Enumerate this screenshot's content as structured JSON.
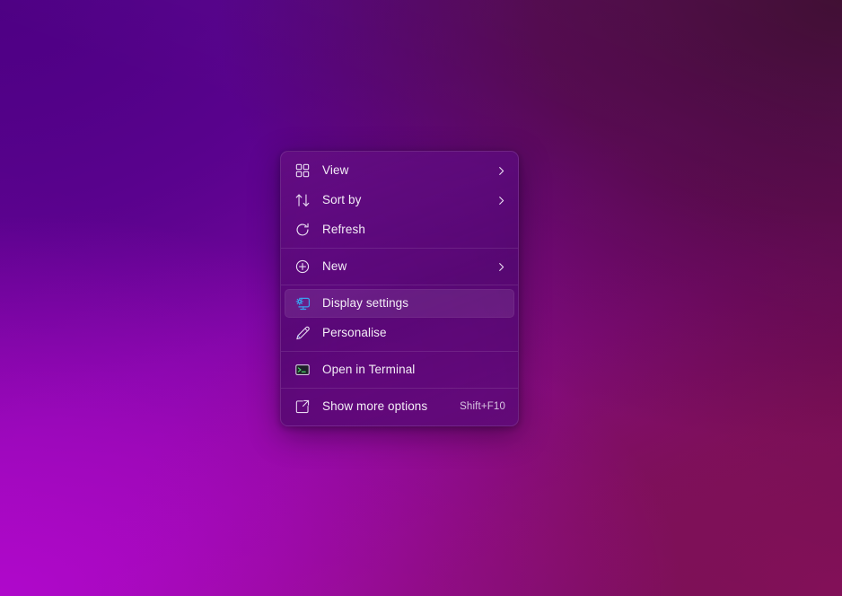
{
  "desktop": {
    "wallpaper_name": "purple-magenta-gradient-wallpaper",
    "colors": {
      "top_left": "#4f0084",
      "top_right": "#3d0a28",
      "bottom_left": "#9c0ab5",
      "bottom_right": "#7d1055",
      "menu_background": "#560974",
      "menu_border": "#ffffff1c",
      "highlight": "#ffffff16",
      "text": "#f4eef7",
      "accel_text": "#d8c6e2",
      "icon_stroke": "#e9dcf2",
      "display_icon_blue": "#3aa0ee",
      "terminal_icon_green": "#4ad26a"
    }
  },
  "context_menu": {
    "name": "desktop-context-menu",
    "sections": [
      {
        "items": [
          {
            "id": "view",
            "label": "View",
            "icon": "grid-view-icon",
            "submenu": true,
            "accel": "",
            "highlighted": false
          },
          {
            "id": "sort-by",
            "label": "Sort by",
            "icon": "sort-arrows-icon",
            "submenu": true,
            "accel": "",
            "highlighted": false
          },
          {
            "id": "refresh",
            "label": "Refresh",
            "icon": "refresh-icon",
            "submenu": false,
            "accel": "",
            "highlighted": false
          }
        ]
      },
      {
        "items": [
          {
            "id": "new",
            "label": "New",
            "icon": "plus-circle-icon",
            "submenu": true,
            "accel": "",
            "highlighted": false
          }
        ]
      },
      {
        "items": [
          {
            "id": "display-settings",
            "label": "Display settings",
            "icon": "monitor-gear-icon",
            "submenu": false,
            "accel": "",
            "highlighted": true
          },
          {
            "id": "personalise",
            "label": "Personalise",
            "icon": "pen-brush-icon",
            "submenu": false,
            "accel": "",
            "highlighted": false
          }
        ]
      },
      {
        "items": [
          {
            "id": "open-in-terminal",
            "label": "Open in Terminal",
            "icon": "terminal-icon",
            "submenu": false,
            "accel": "",
            "highlighted": false
          }
        ]
      },
      {
        "items": [
          {
            "id": "show-more-options",
            "label": "Show more options",
            "icon": "show-more-options-icon",
            "submenu": false,
            "accel": "Shift+F10",
            "highlighted": false
          }
        ]
      }
    ]
  }
}
